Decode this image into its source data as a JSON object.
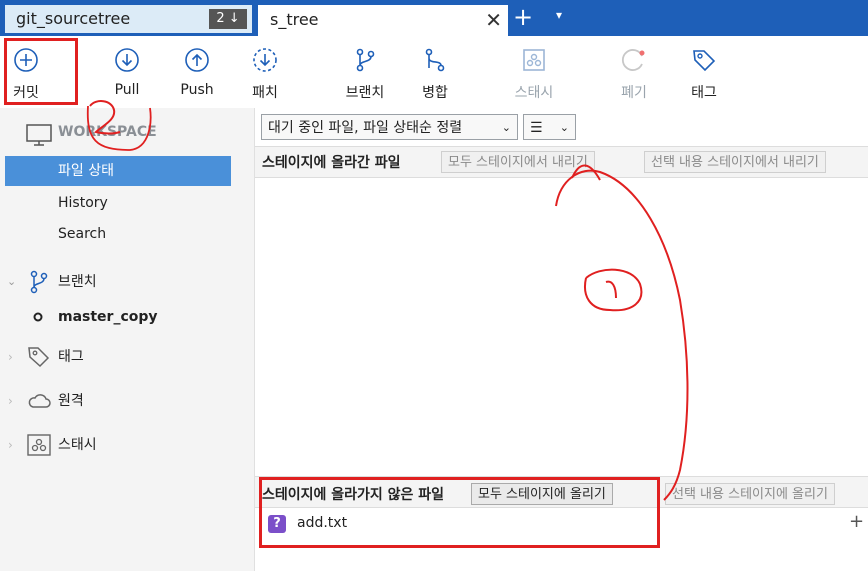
{
  "tabs": {
    "repo_tab": {
      "label": "git_sourcetree",
      "badge": "2 ↓"
    },
    "active_tab": {
      "label": "s_tree",
      "close_glyph": "✕"
    },
    "new_tab_glyph": "+",
    "tab_menu_glyph": "▾"
  },
  "toolbar": {
    "commit": "커밋",
    "pull": "Pull",
    "push": "Push",
    "patch": "패치",
    "branch": "브랜치",
    "merge": "병합",
    "stash": "스태시",
    "discard": "폐기",
    "tag": "태그"
  },
  "sidebar": {
    "workspace_label": "WORKSPACE",
    "workspace_items": [
      "파일 상태",
      "History",
      "Search"
    ],
    "branches_label": "브랜치",
    "current_branch": "master_copy",
    "tags_label": "태그",
    "remotes_label": "원격",
    "stashes_label": "스태시"
  },
  "filters": {
    "status_filter": "대기 중인 파일, 파일 상태순 정렬",
    "view_mode_glyph": "☰"
  },
  "staged": {
    "title": "스테이지에 올라간 파일",
    "unstage_all": "모두 스테이지에서 내리기",
    "unstage_selected": "선택 내용 스테이지에서 내리기",
    "files": []
  },
  "unstaged": {
    "title": "스테이지에 올라가지 않은 파일",
    "stage_all": "모두 스테이지에 올리기",
    "stage_selected": "선택 내용 스테이지에 올리기",
    "files": [
      {
        "name": "add.txt",
        "status_glyph": "?"
      }
    ]
  },
  "annotations": {
    "number_1": "1",
    "number_2": "2"
  },
  "colors": {
    "tabbar": "#1e5fb8",
    "selection": "#4a90d9",
    "annotation_red": "#e02020",
    "untracked_badge": "#7b4fc9"
  }
}
